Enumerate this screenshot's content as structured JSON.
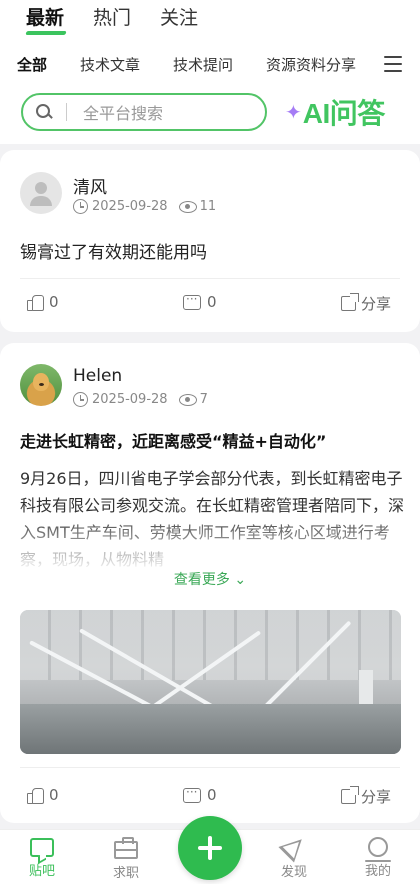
{
  "header": {
    "main_tabs": [
      {
        "label": "最新",
        "active": true
      },
      {
        "label": "热门",
        "active": false
      },
      {
        "label": "关注",
        "active": false
      }
    ],
    "category_tabs": [
      {
        "label": "全部",
        "active": true
      },
      {
        "label": "技术文章",
        "active": false
      },
      {
        "label": "技术提问",
        "active": false
      },
      {
        "label": "资源资料分享",
        "active": false
      }
    ],
    "menu_icon": "hamburger-menu-icon"
  },
  "search": {
    "placeholder": "全平台搜索",
    "icon": "search-icon"
  },
  "ai_button": {
    "label": "AI问答",
    "spark_icon": "sparkle-icon",
    "color": "#41c560"
  },
  "posts": [
    {
      "author": "清风",
      "avatar": "default-avatar",
      "date": "2025-09-28",
      "views": "11",
      "text": "锡膏过了有效期还能用吗",
      "likes": "0",
      "comments": "0",
      "share_label": "分享"
    },
    {
      "author": "Helen",
      "avatar": "dog-avatar",
      "date": "2025-09-28",
      "views": "7",
      "title": "走进长虹精密，近距离感受“精益+自动化”",
      "body": "9月26日，四川省电子学会部分代表，到长虹精密电子科技有限公司参观交流。在长虹精密管理者陪同下，深入SMT生产车间、劳模大师工作室等核心区域进行考察，现场，从物料精",
      "see_more": "查看更多",
      "image": "factory-workshop-photo",
      "likes": "0",
      "comments": "0",
      "share_label": "分享"
    }
  ],
  "bottom_nav": {
    "items": [
      {
        "label": "贴吧",
        "icon": "chat-bubble-icon",
        "active": true
      },
      {
        "label": "求职",
        "icon": "briefcase-icon",
        "active": false
      },
      {
        "label": "发现",
        "icon": "send-icon",
        "active": false
      },
      {
        "label": "我的",
        "icon": "user-icon",
        "active": false
      }
    ],
    "fab_icon": "plus-icon",
    "accent": "#2fbb4f"
  }
}
